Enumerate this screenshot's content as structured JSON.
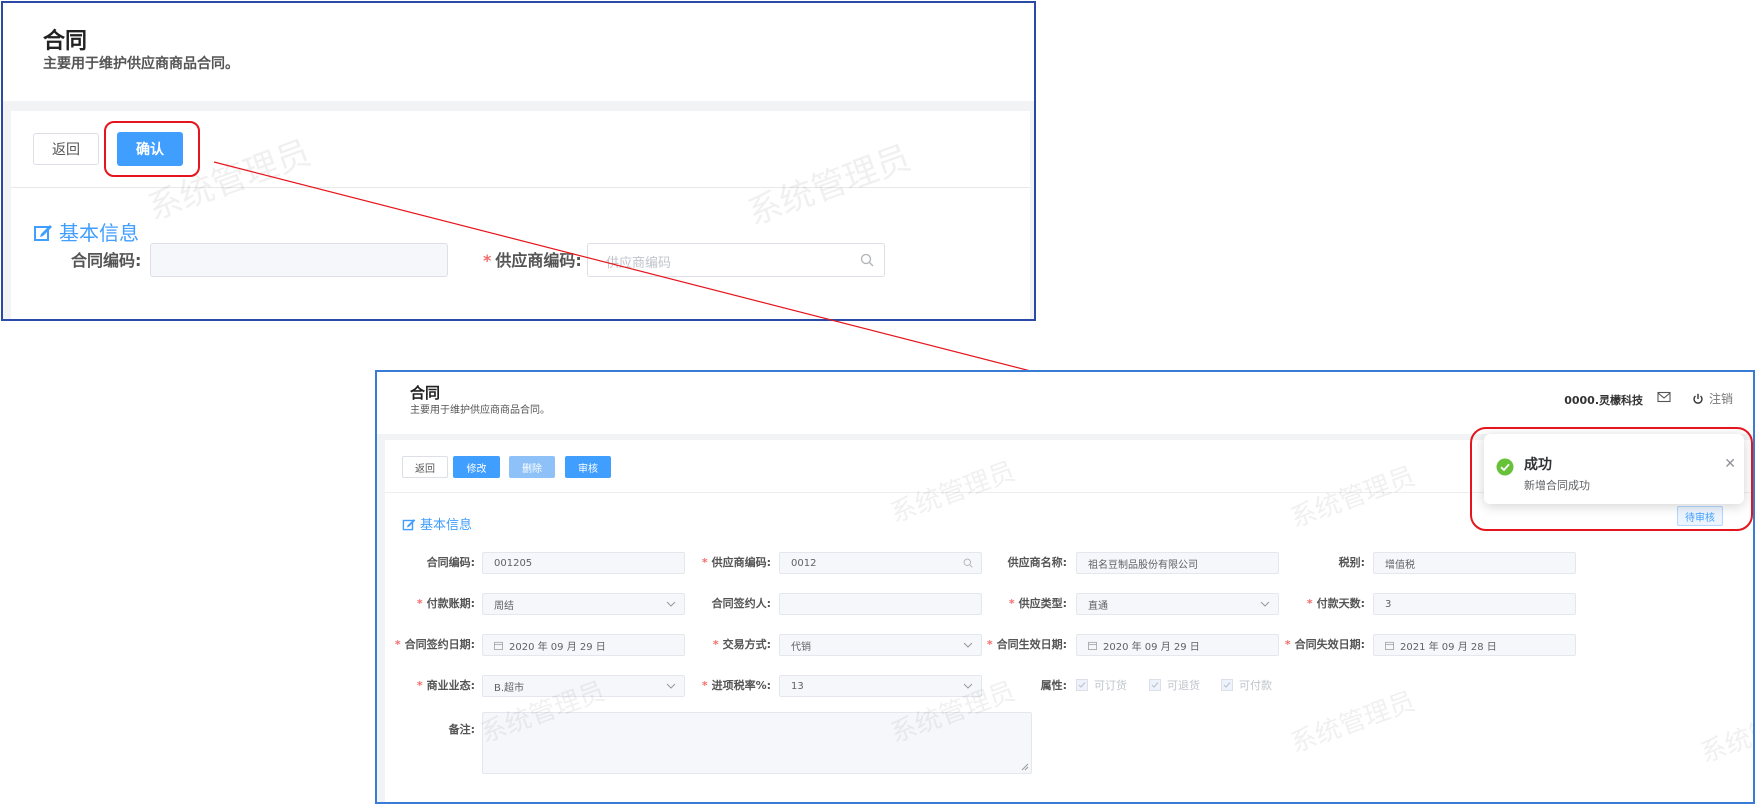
{
  "watermark": "系统管理员",
  "top": {
    "title": "合同",
    "subtitle": "主要用于维护供应商商品合同。",
    "back_label": "返回",
    "confirm_label": "确认",
    "section_title": "基本信息",
    "contract_code_label": "合同编码:",
    "supplier_code_label": "供应商编码:",
    "supplier_code_placeholder": "供应商编码"
  },
  "bottom": {
    "title": "合同",
    "subtitle": "主要用于维护供应商商品合同。",
    "org": "0000.灵檬科技",
    "logout_label": "注销",
    "toolbar": {
      "back": "返回",
      "edit": "修改",
      "delete": "删除",
      "audit": "审核"
    },
    "section_title": "基本信息",
    "status": "待审核",
    "fields": {
      "contract_code": {
        "label": "合同编码:",
        "value": "001205"
      },
      "supplier_code": {
        "label": "供应商编码:",
        "value": "0012"
      },
      "supplier_name": {
        "label": "供应商名称:",
        "value": "祖名豆制品股份有限公司"
      },
      "tax_type": {
        "label": "税别:",
        "value": "增值税"
      },
      "payment_period": {
        "label": "付款账期:",
        "value": "周结"
      },
      "signer": {
        "label": "合同签约人:",
        "value": ""
      },
      "supply_type": {
        "label": "供应类型:",
        "value": "直通"
      },
      "payment_days": {
        "label": "付款天数:",
        "value": "3"
      },
      "sign_date": {
        "label": "合同签约日期:",
        "value": "2020 年 09 月 29 日"
      },
      "trade_mode": {
        "label": "交易方式:",
        "value": "代销"
      },
      "effective_date": {
        "label": "合同生效日期:",
        "value": "2020 年 09 月 29 日"
      },
      "expire_date": {
        "label": "合同失效日期:",
        "value": "2021 年 09 月 28 日"
      },
      "business_format": {
        "label": "商业业态:",
        "value": "B.超市"
      },
      "input_tax_rate": {
        "label": "进项税率%:",
        "value": "13"
      },
      "attributes_label": "属性:",
      "attributes": [
        "可订货",
        "可退货",
        "可付款"
      ],
      "remark_label": "备注:"
    }
  },
  "notification": {
    "title": "成功",
    "message": "新增合同成功"
  },
  "colors": {
    "primary": "#409eff",
    "highlight": "#e5151d",
    "success": "#67c23a"
  }
}
